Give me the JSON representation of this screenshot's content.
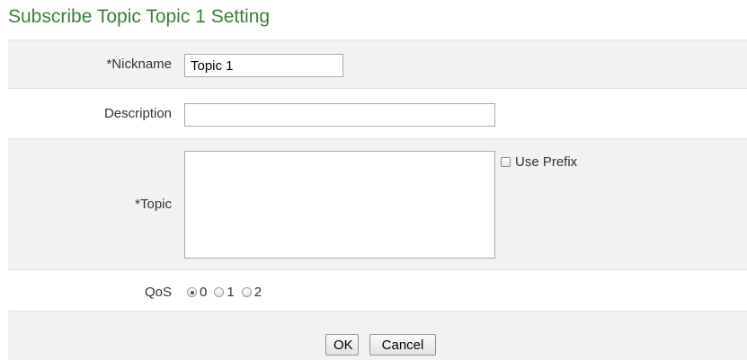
{
  "header": {
    "title": "Subscribe Topic Topic 1 Setting"
  },
  "form": {
    "nickname": {
      "label": "*Nickname",
      "value": "Topic 1"
    },
    "description": {
      "label": "Description",
      "value": ""
    },
    "topic": {
      "label": "*Topic",
      "value": "",
      "use_prefix_label": "Use Prefix",
      "use_prefix_checked": false
    },
    "qos": {
      "label": "QoS",
      "options": [
        "0",
        "1",
        "2"
      ],
      "selected": "0"
    }
  },
  "buttons": {
    "ok": "OK",
    "cancel": "Cancel"
  },
  "colors": {
    "title": "#3a7f35",
    "row_alt_bg": "#f2f2f2",
    "divider": "#e0e0e0"
  }
}
